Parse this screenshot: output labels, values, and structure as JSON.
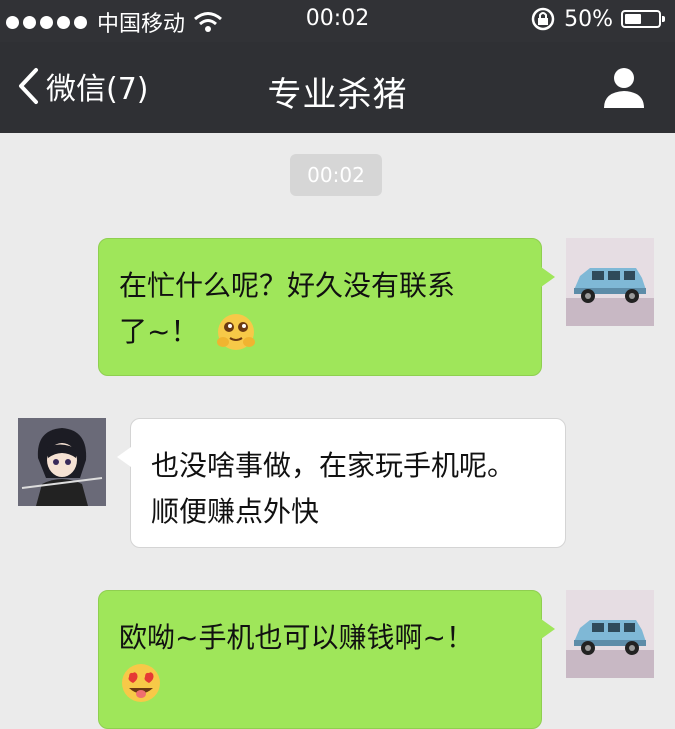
{
  "status_bar": {
    "carrier": "中国移动",
    "time": "00:02",
    "battery_text": "50%",
    "battery_level": 0.5
  },
  "nav": {
    "back_label": "微信(7)",
    "title": "专业杀猪"
  },
  "chat": {
    "timestamp": "00:02",
    "messages": [
      {
        "side": "right",
        "line1": "在忙什么呢？好久没有联系",
        "line2": "了~！",
        "emoji": "hug-face-emoji"
      },
      {
        "side": "left",
        "line1": "也没啥事做，在家玩手机呢。",
        "line2": "顺便赚点外快"
      },
      {
        "side": "right",
        "line1": "欧呦~手机也可以赚钱啊~！",
        "emoji": "heart-eyes-tongue-emoji"
      }
    ]
  },
  "colors": {
    "header": "#2f3034",
    "chat_bg": "#ebebeb",
    "outgoing_bubble": "#9fe65a",
    "incoming_bubble": "#ffffff"
  }
}
